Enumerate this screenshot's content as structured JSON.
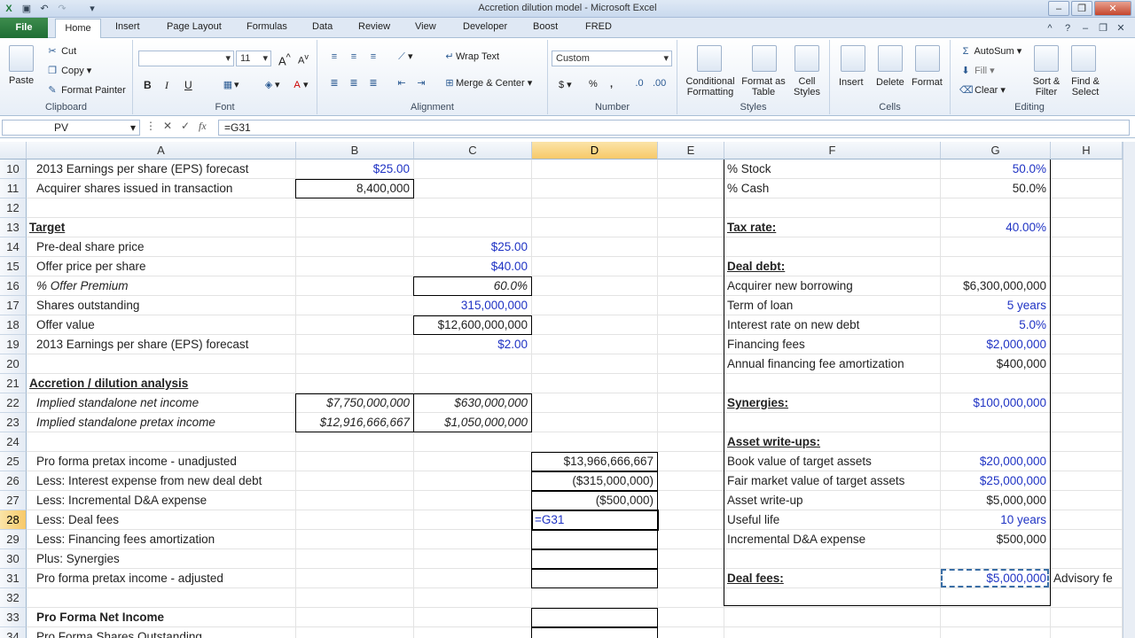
{
  "window": {
    "title": "Accretion dilution model - Microsoft Excel"
  },
  "tabs": [
    "File",
    "Home",
    "Insert",
    "Page Layout",
    "Formulas",
    "Data",
    "Review",
    "View",
    "Developer",
    "Boost",
    "FRED"
  ],
  "ribbon": {
    "clipboard": {
      "paste": "Paste",
      "cut": "Cut",
      "copy": "Copy",
      "format_painter": "Format Painter",
      "label": "Clipboard"
    },
    "font": {
      "size": "11",
      "bold": "B",
      "italic": "I",
      "underline": "U",
      "label": "Font"
    },
    "alignment": {
      "wrap_text": "Wrap Text",
      "merge_center": "Merge & Center",
      "label": "Alignment"
    },
    "number": {
      "format": "Custom",
      "currency": "$",
      "percent": "%",
      "comma": ",",
      "label": "Number"
    },
    "styles": {
      "conditional": "Conditional Formatting",
      "format_table": "Format as Table",
      "cell_styles": "Cell Styles",
      "label": "Styles"
    },
    "cells": {
      "insert": "Insert",
      "delete": "Delete",
      "format": "Format",
      "label": "Cells"
    },
    "editing": {
      "autosum": "AutoSum",
      "fill": "Fill",
      "clear": "Clear",
      "sort_filter": "Sort & Filter",
      "find_select": "Find & Select",
      "label": "Editing"
    }
  },
  "formula_bar": {
    "name_box": "PV",
    "formula": "=G31"
  },
  "columns": [
    "A",
    "B",
    "C",
    "D",
    "E",
    "F",
    "G",
    "H"
  ],
  "rows": [
    {
      "n": "10",
      "A": "2013 Earnings per share (EPS) forecast",
      "B": "$25.00",
      "F": "% Stock",
      "G": "50.0%"
    },
    {
      "n": "11",
      "A": "Acquirer shares issued in transaction",
      "B": "8,400,000",
      "F": "% Cash",
      "G": "50.0%"
    },
    {
      "n": "12"
    },
    {
      "n": "13",
      "A": "Target",
      "F": "Tax rate:",
      "G": "40.00%"
    },
    {
      "n": "14",
      "A": "Pre-deal share price",
      "C": "$25.00"
    },
    {
      "n": "15",
      "A": "Offer price per share",
      "C": "$40.00",
      "F": "Deal debt:"
    },
    {
      "n": "16",
      "A": "% Offer Premium",
      "C": "60.0%",
      "F": "Acquirer new borrowing",
      "G": "$6,300,000,000"
    },
    {
      "n": "17",
      "A": "Shares outstanding",
      "C": "315,000,000",
      "F": "Term of loan",
      "G": "5 years"
    },
    {
      "n": "18",
      "A": "Offer value",
      "C": "$12,600,000,000",
      "F": "Interest rate on new debt",
      "G": "5.0%"
    },
    {
      "n": "19",
      "A": "2013 Earnings per share (EPS) forecast",
      "C": "$2.00",
      "F": "Financing fees",
      "G": "$2,000,000"
    },
    {
      "n": "20",
      "F": "Annual financing fee amortization",
      "G": "$400,000"
    },
    {
      "n": "21",
      "A": "Accretion / dilution analysis"
    },
    {
      "n": "22",
      "A": "Implied standalone net income",
      "B": "$7,750,000,000",
      "C": "$630,000,000",
      "F": "Synergies:",
      "G": "$100,000,000"
    },
    {
      "n": "23",
      "A": "Implied standalone pretax income",
      "B": "$12,916,666,667",
      "C": "$1,050,000,000"
    },
    {
      "n": "24",
      "F": "Asset write-ups:"
    },
    {
      "n": "25",
      "A": "Pro forma pretax income - unadjusted",
      "D": "$13,966,666,667",
      "F": "Book value of target assets",
      "G": "$20,000,000"
    },
    {
      "n": "26",
      "A": "Less: Interest expense from new deal debt",
      "D": "($315,000,000)",
      "F": "Fair market value of target assets",
      "G": "$25,000,000"
    },
    {
      "n": "27",
      "A": "Less: Incremental D&A expense",
      "D": "($500,000)",
      "F": "Asset write-up",
      "G": "$5,000,000"
    },
    {
      "n": "28",
      "A": "Less: Deal fees",
      "D": "=G31",
      "F": "Useful life",
      "G": "10 years"
    },
    {
      "n": "29",
      "A": "Less: Financing fees amortization",
      "F": "Incremental D&A expense",
      "G": "$500,000"
    },
    {
      "n": "30",
      "A": "Plus: Synergies"
    },
    {
      "n": "31",
      "A": "Pro forma pretax income - adjusted",
      "F": "Deal fees:",
      "G": "$5,000,000",
      "H": "Advisory fe"
    },
    {
      "n": "32"
    },
    {
      "n": "33",
      "A": "Pro Forma Net Income"
    },
    {
      "n": "34",
      "A": "Pro Forma Shares Outstanding"
    }
  ]
}
